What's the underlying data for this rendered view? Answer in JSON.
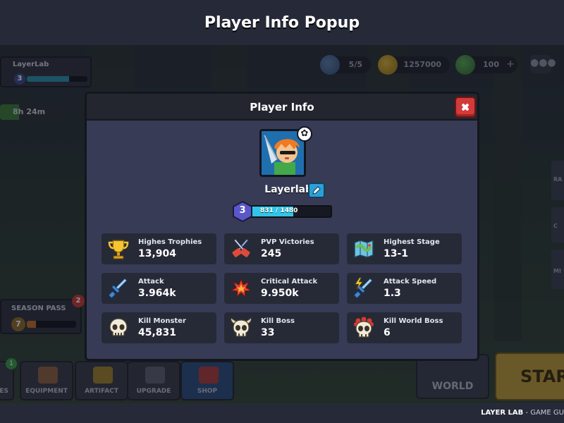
{
  "page_title": "Player Info Popup",
  "hud": {
    "player_name": "LayerLab",
    "player_level": "3",
    "timer": "8h 24m",
    "shields": "5/5",
    "gold": "1257000",
    "gems": "100",
    "gem_plus": "+",
    "chat_icon": "chat-bubble-icon",
    "season_pass_label": "SEASON PASS",
    "season_level": "7",
    "season_badge": "2",
    "side_labels": [
      "RA",
      "C",
      "MI"
    ]
  },
  "nav": {
    "items": [
      {
        "label": "ES",
        "badge": "1"
      },
      {
        "label": "EQUIPMENT"
      },
      {
        "label": "ARTIFACT"
      },
      {
        "label": "UPGRADE"
      },
      {
        "label": "SHOP"
      }
    ],
    "world_label": "WORLD",
    "start_label": "START"
  },
  "footer": {
    "brand": "LAYER LAB",
    "suffix": " - GAME GU"
  },
  "popup": {
    "title": "Player Info",
    "player_name": "Layerlab",
    "level": "3",
    "xp_text": "831 / 1480",
    "xp_current": 831,
    "xp_max": 1480,
    "stats": [
      {
        "label": "Highes Trophies",
        "value": "13,904",
        "icon": "trophy-icon"
      },
      {
        "label": "PVP Victories",
        "value": "245",
        "icon": "crossed-swords-icon"
      },
      {
        "label": "Highest Stage",
        "value": "13-1",
        "icon": "map-icon"
      },
      {
        "label": "Attack",
        "value": "3.964k",
        "icon": "sword-icon"
      },
      {
        "label": "Critical Attack",
        "value": "9.950k",
        "icon": "explosion-icon"
      },
      {
        "label": "Attack Speed",
        "value": "1.3",
        "icon": "lightning-sword-icon"
      },
      {
        "label": "Kill Monster",
        "value": "45,831",
        "icon": "skull-icon"
      },
      {
        "label": "Kill Boss",
        "value": "33",
        "icon": "horned-skull-icon"
      },
      {
        "label": "Kill World Boss",
        "value": "6",
        "icon": "crowned-skull-icon"
      }
    ]
  },
  "colors": {
    "popup_bg": "#383b55",
    "popup_header": "#23262f",
    "close_red": "#d33a3a",
    "xp_cyan": "#30c6e8",
    "level_badge": "#5a58c9",
    "stat_card": "#262a37"
  }
}
